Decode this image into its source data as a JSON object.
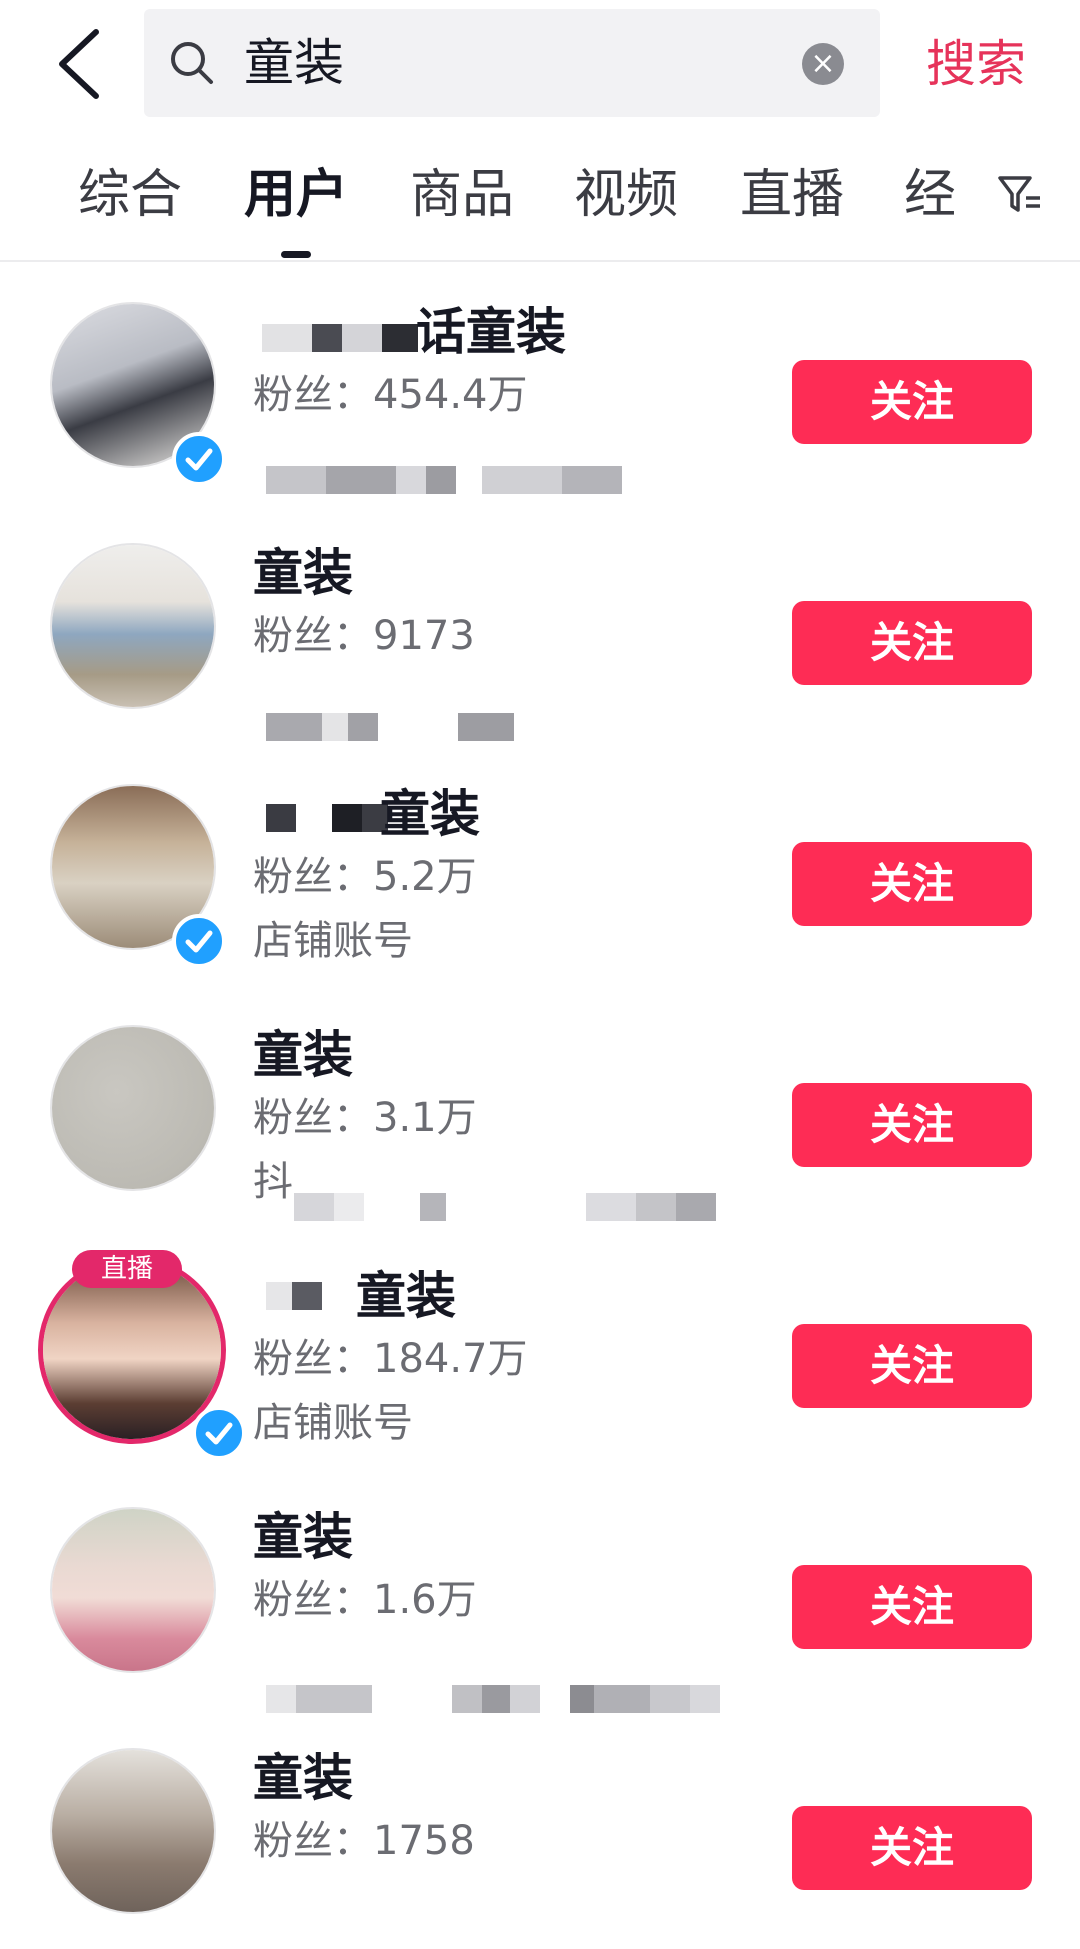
{
  "header": {
    "back_icon": "chevron-left-icon",
    "search": {
      "query": "童装",
      "search_icon": "search-icon",
      "clear_icon": "close-circle-icon"
    },
    "search_button": "搜索"
  },
  "tabs": {
    "items": [
      "综合",
      "用户",
      "商品",
      "视频",
      "直播",
      "经"
    ],
    "active": "用户",
    "filter_icon": "filter-icon"
  },
  "colors": {
    "accent": "#fe2c55",
    "search_text": "#e6335a",
    "live_ring": "#e3286a",
    "verify_blue": "#20a0ff"
  },
  "users": [
    {
      "name": "话童装",
      "fans": "粉丝：454.4万",
      "desc": "",
      "verified": true,
      "live": false,
      "follow": "关注"
    },
    {
      "name": "童装",
      "fans": "粉丝：9173",
      "desc": "",
      "verified": false,
      "live": false,
      "follow": "关注"
    },
    {
      "name": "童装",
      "fans": "粉丝：5.2万",
      "desc": "店铺账号",
      "verified": true,
      "live": false,
      "follow": "关注"
    },
    {
      "name": "童装",
      "fans": "粉丝：3.1万",
      "desc": "抖",
      "verified": false,
      "live": false,
      "follow": "关注"
    },
    {
      "name": "童装",
      "fans": "粉丝：184.7万",
      "desc": "店铺账号",
      "verified": true,
      "live": true,
      "live_label": "直播",
      "follow": "关注"
    },
    {
      "name": "童装",
      "fans": "粉丝：1.6万",
      "desc": "",
      "verified": false,
      "live": false,
      "follow": "关注"
    },
    {
      "name": "童装",
      "fans": "粉丝：1758",
      "desc": "",
      "verified": false,
      "live": false,
      "follow": "关注"
    }
  ]
}
